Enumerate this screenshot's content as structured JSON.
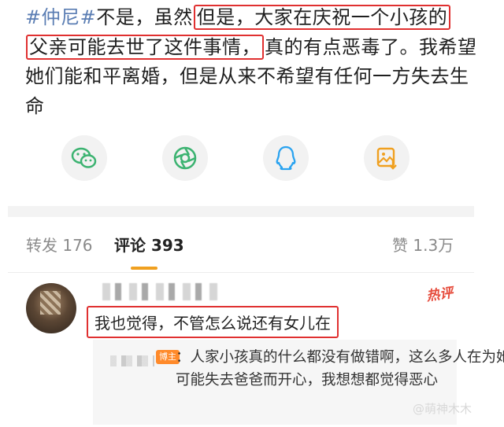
{
  "post": {
    "topic": "#仲尼#",
    "text_before": "不是，虽然",
    "highlight_1": "但是，大家在庆祝一个小孩的",
    "highlight_2": "父亲可能去世了这件事情，",
    "text_after": "真的有点恶毒了。我希望她们能和平离婚，但是从来不希望有任何一方失去生命"
  },
  "share": [
    {
      "icon": "wechat-icon",
      "color": "#3cb371"
    },
    {
      "icon": "moments-icon",
      "color": "#3cb371"
    },
    {
      "icon": "qq-icon",
      "color": "#2aa3f0"
    },
    {
      "icon": "save-image-icon",
      "color": "#f0a020"
    }
  ],
  "stats": {
    "repost": "转发 176",
    "comment": "评论 393",
    "like": "赞 1.3万"
  },
  "comment": {
    "hot_badge": "热评",
    "text": "我也觉得，不管怎么说还有女儿在",
    "reply": {
      "badge": "博主",
      "text": "：人家小孩真的什么都没有做错啊，这么多人在为她可能失去爸爸而开心，我想想都觉得恶心"
    }
  },
  "watermark": "@萌神木木",
  "colors": {
    "topic": "#5a7db3",
    "highlight_border": "#e03030",
    "accent": "#f0a020"
  }
}
